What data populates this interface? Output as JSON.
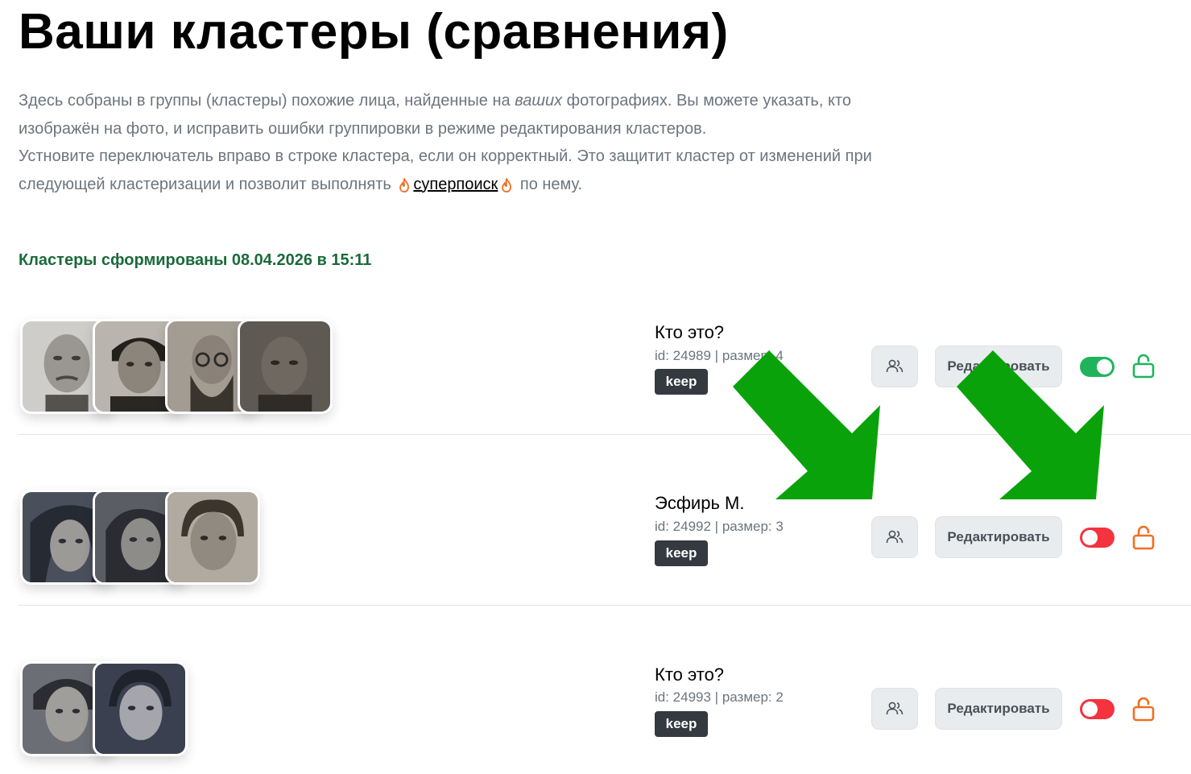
{
  "page": {
    "title": "Ваши кластеры (сравнения)",
    "intro_line1_pre": "Здесь собраны в группы (кластеры) похожие лица, найденные на ",
    "intro_line1_em": "ваших",
    "intro_line1_post": " фотографиях. Вы можете указать, кто изображён на фото, и исправить ошибки группировки в режиме редактирования кластеров.",
    "intro_line2_pre": "Устновите переключатель вправо в строке кластера, если он корректный. Это защитит кластер от изменений при следующей кластеризации и позволит выполнять",
    "superlink": "суперпоиск",
    "intro_line2_post": "по нему.",
    "formed": "Кластеры сформированы 08.04.2026 в 15:11"
  },
  "icons": {
    "fire": "fire-icon",
    "people": "people-icon",
    "lock_open": "lock-open-icon",
    "arrow": "arrow-down-right-icon"
  },
  "colors": {
    "green": "#1fb45c",
    "red": "#f4333f",
    "orange": "#f36d21",
    "arrow": "#0aa20a",
    "badge": "#343a40"
  },
  "clusters": [
    {
      "name": "Кто это?",
      "meta": "id: 24989 | размер: 4",
      "badge": "keep",
      "edit_label": "Редактировать",
      "protected": true
    },
    {
      "name": "Эсфирь М.",
      "meta": "id: 24992 | размер: 3",
      "badge": "keep",
      "edit_label": "Редактировать",
      "protected": false
    },
    {
      "name": "Кто это?",
      "meta": "id: 24993 | размер: 2",
      "badge": "keep",
      "edit_label": "Редактировать",
      "protected": false
    }
  ]
}
